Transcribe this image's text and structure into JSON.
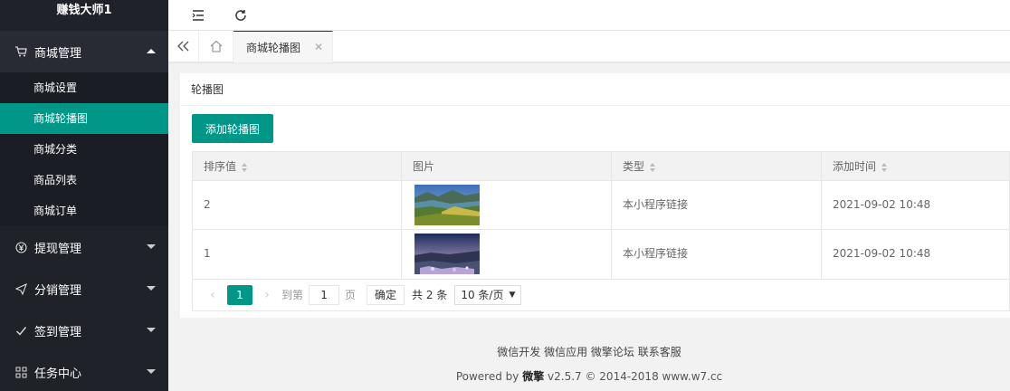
{
  "brand": "赚钱大师1",
  "menu": {
    "shop": "商城管理",
    "shop_items": [
      "商城设置",
      "商城轮播图",
      "商城分类",
      "商品列表",
      "商城订单"
    ],
    "withdraw": "提现管理",
    "distribution": "分销管理",
    "checkin": "签到管理",
    "tasks": "任务中心"
  },
  "tabs": {
    "active": "商城轮播图"
  },
  "card": {
    "title": "轮播图",
    "add_button": "添加轮播图",
    "columns": [
      "排序值",
      "图片",
      "类型",
      "添加时间"
    ],
    "rows": [
      {
        "order": "2",
        "type": "本小程序链接",
        "time": "2021-09-02 10:48"
      },
      {
        "order": "1",
        "type": "本小程序链接",
        "time": "2021-09-02 10:48"
      }
    ]
  },
  "pager": {
    "current": "1",
    "goto": "到第",
    "page_input": "1",
    "page_unit": "页",
    "confirm": "确定",
    "total": "共 2 条",
    "page_size": "10 条/页"
  },
  "footer": {
    "links": "微信开发 微信应用 微擎论坛 联系客服",
    "powered": "Powered by ",
    "brand": "微擎",
    "rest": " v2.5.7 © 2014-2018 ",
    "site": "www.w7.cc"
  },
  "colors": {
    "accent": "#009688",
    "sidebar": "#20222a"
  }
}
